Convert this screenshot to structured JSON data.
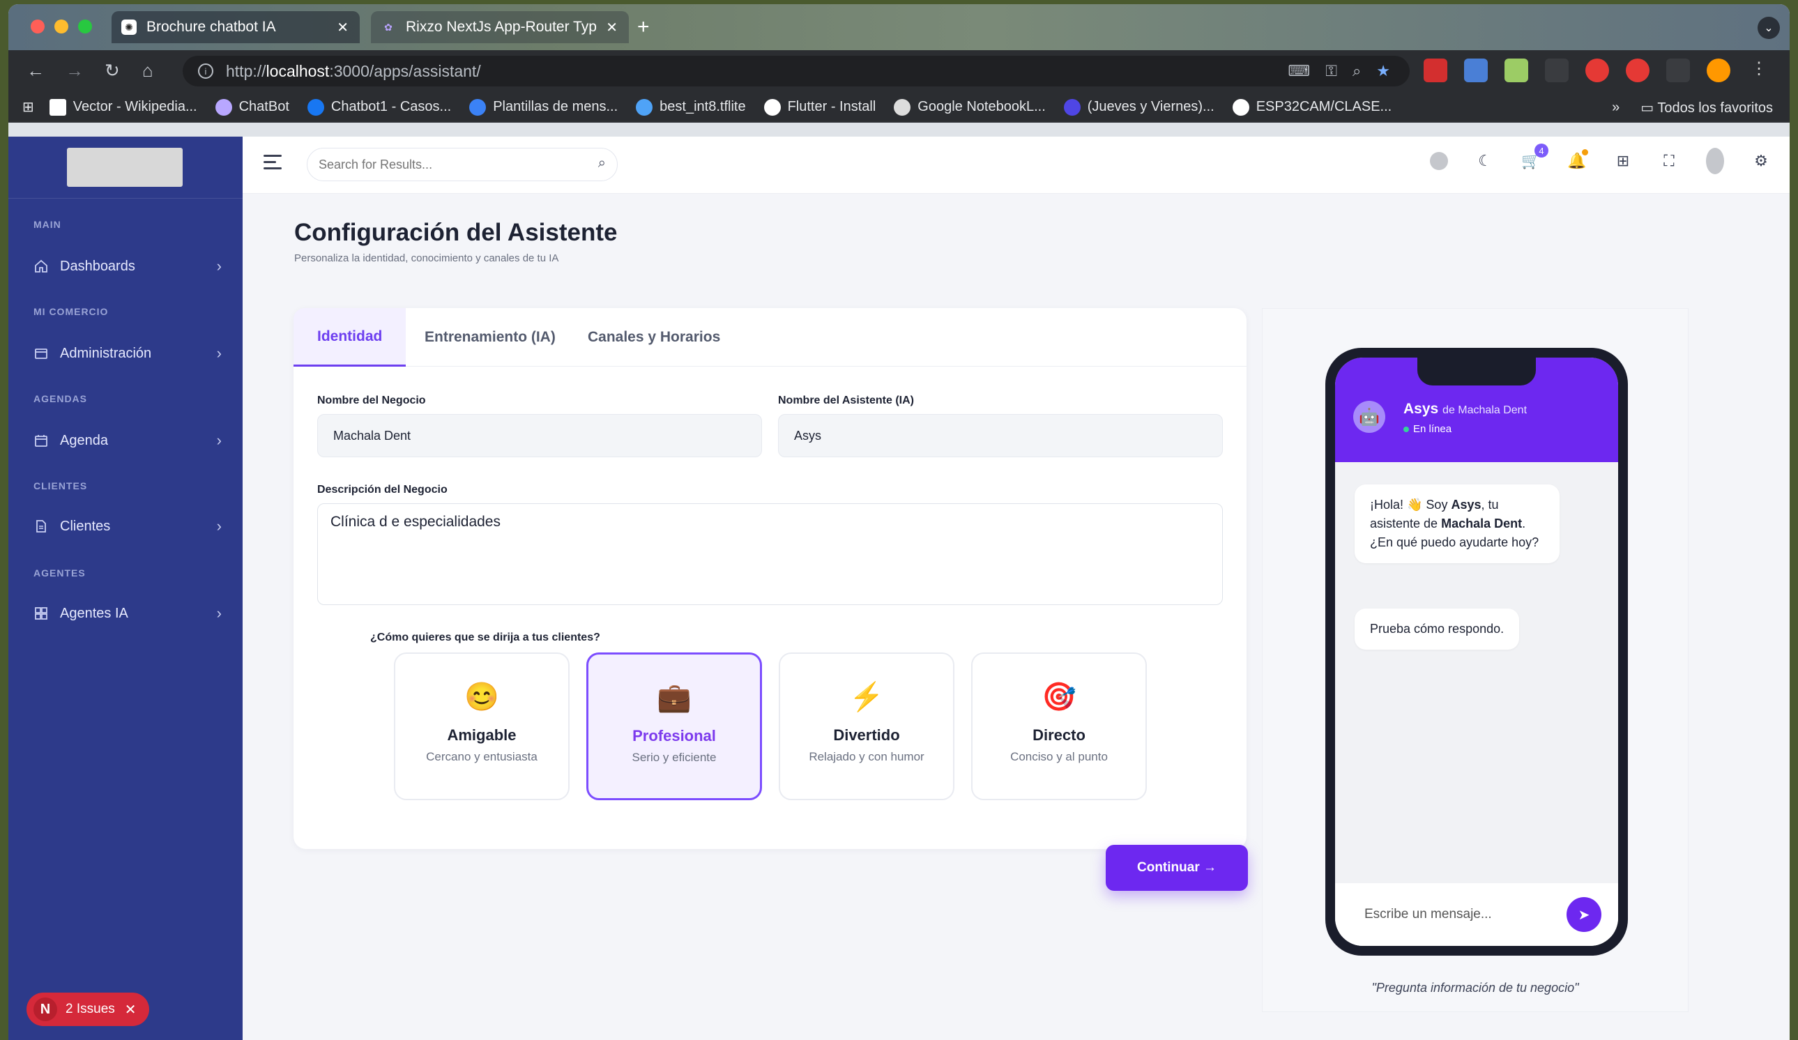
{
  "browser": {
    "tabs": [
      {
        "title": "Brochure chatbot IA",
        "close": "✕"
      },
      {
        "title": "Rixzo NextJs App-Router Typ",
        "close": "✕"
      }
    ],
    "new_tab": "+",
    "url_prefix": "http://",
    "url_host": "localhost",
    "url_rest": ":3000/apps/assistant/",
    "bookmarks": [
      "Vector - Wikipedia...",
      "ChatBot",
      "Chatbot1 - Casos...",
      "Plantillas de mens...",
      "best_int8.tflite",
      "Flutter - Install",
      "Google NotebookL...",
      "(Jueves y Viernes)...",
      "ESP32CAM/CLASE..."
    ],
    "bookmarks_more": "»",
    "all_bookmarks": "Todos los favoritos"
  },
  "sidebar": {
    "sections": [
      {
        "label": "MAIN",
        "item": "Dashboards",
        "icon": "home-icon"
      },
      {
        "label": "MI COMERCIO",
        "item": "Administración",
        "icon": "store-icon"
      },
      {
        "label": "AGENDAS",
        "item": "Agenda",
        "icon": "calendar-icon"
      },
      {
        "label": "CLIENTES",
        "item": "Clientes",
        "icon": "file-icon"
      },
      {
        "label": "AGENTES",
        "item": "Agentes IA",
        "icon": "grid-icon"
      }
    ],
    "issues_badge": "N",
    "issues_label": "2 Issues",
    "issues_close": "✕"
  },
  "topbar": {
    "search_placeholder": "Search for Results...",
    "cart_count": "4"
  },
  "page": {
    "title": "Configuración del Asistente",
    "subtitle": "Personaliza la identidad, conocimiento y canales de tu IA"
  },
  "tabs": [
    "Identidad",
    "Entrenamiento (IA)",
    "Canales y Horarios"
  ],
  "form": {
    "business_name_label": "Nombre del Negocio",
    "business_name_value": "Machala Dent",
    "assistant_name_label": "Nombre del Asistente (IA)",
    "assistant_name_value": "Asys",
    "description_label": "Descripción del Negocio",
    "description_value": "Clínica d e especialidades",
    "tone_question": "¿Cómo quieres que se dirija a tus clientes?",
    "tones": [
      {
        "emoji": "😊",
        "name": "Amigable",
        "desc": "Cercano y entusiasta",
        "selected": false
      },
      {
        "emoji": "💼",
        "name": "Profesional",
        "desc": "Serio y eficiente",
        "selected": true
      },
      {
        "emoji": "⚡",
        "name": "Divertido",
        "desc": "Relajado y con humor",
        "selected": false
      },
      {
        "emoji": "🎯",
        "name": "Directo",
        "desc": "Conciso y al punto",
        "selected": false
      }
    ],
    "continue_label": "Continuar →"
  },
  "preview": {
    "bot_avatar": "🤖",
    "bot_name": "Asys",
    "bot_of": "de Machala Dent",
    "status": "En línea",
    "greeting_parts": [
      "¡Hola! 👋 Soy ",
      "Asys",
      ", tu asistente de ",
      "Machala Dent",
      ". ¿En qué puedo ayudarte hoy?"
    ],
    "message2": "Prueba cómo respondo.",
    "input_placeholder": "Escribe un mensaje...",
    "caption": "\"Pregunta información de tu negocio\""
  },
  "colors": {
    "sidebar": "#2d3a8a",
    "accent": "#6d28f0",
    "selected_tone_border": "#7c4dff"
  }
}
